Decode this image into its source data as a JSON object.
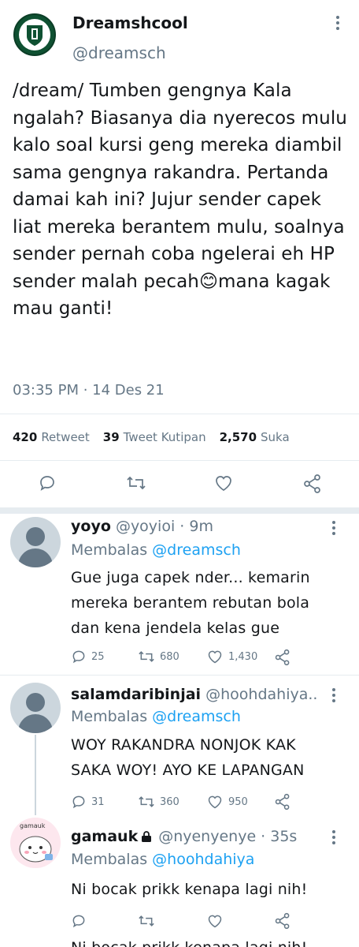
{
  "tweet": {
    "display_name": "Dreamshcool",
    "handle": "@dreamsch",
    "text": "/dream/ Tumben gengnya Kala ngalah? Biasanya dia nyerecos mulu kalo soal kursi geng mereka diambil sama gengnya rakandra. Pertanda damai kah ini? Jujur sender capek liat mereka berantem mulu, soalnya sender pernah coba ngelerai eh HP sender malah pecah😊mana kagak mau ganti!",
    "timestamp": "03:35 PM · 14 Des 21",
    "stats": {
      "retweets": "420",
      "retweets_label": "Retweet",
      "quotes": "39",
      "quotes_label": "Tweet Kutipan",
      "likes": "2,570",
      "likes_label": "Suka"
    }
  },
  "replies": [
    {
      "name": "yoyo",
      "handle": "@yoyioi · 9m",
      "replying_label": "Membalas",
      "replying_to": "@dreamsch",
      "text": "Gue juga capek nder... kemarin mereka berantem rebutan bola dan kena jendela kelas gue",
      "reply_count": "25",
      "retweet_count": "680",
      "like_count": "1,430"
    },
    {
      "name": "salamdaribinjai",
      "handle": "@hoohdahiya..",
      "replying_label": "Membalas",
      "replying_to": "@dreamsch",
      "text": "WOY RAKANDRA NONJOK KAK SAKA WOY! AYO KE LAPANGAN",
      "reply_count": "31",
      "retweet_count": "360",
      "like_count": "950"
    },
    {
      "name": "gamauk",
      "avatar_label": "gamauk",
      "handle": "@nyenyenye · 35s",
      "replying_label": "Membalas",
      "replying_to": "@hoohdahiya",
      "text": "Ni bocak prikk kenapa lagi nih!",
      "reply_count": "",
      "retweet_count": "",
      "like_count": ""
    }
  ],
  "cutoff_text": "Ni bocak prikk kenapa lagi nih!",
  "icons": [
    "reply-icon",
    "retweet-icon",
    "like-icon",
    "share-icon",
    "more-icon",
    "lock-icon"
  ],
  "colors": {
    "link": "#1da1f2",
    "muted": "#657786",
    "divider": "#e6ecf0"
  }
}
